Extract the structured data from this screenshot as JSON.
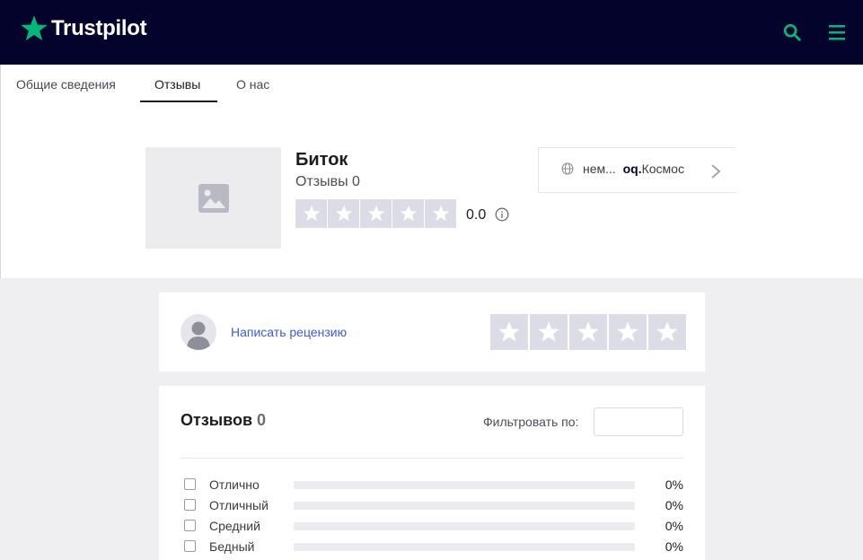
{
  "header": {
    "logo_text": "Trustpilot",
    "accent": "#00b67a",
    "background": "#04032c"
  },
  "tabs": [
    {
      "label": "Общие сведения"
    },
    {
      "label": "Отзывы",
      "active": true
    },
    {
      "label": "О нас"
    }
  ],
  "company": {
    "name": "Биток",
    "reviews_label": "Отзывы 0",
    "rating": "0.0",
    "stars_filled": 0,
    "website_prefix": "нем...",
    "website_domain": "oq.",
    "website_suffix": "Космос"
  },
  "write_review": {
    "link": "Написать рецензию"
  },
  "reviews": {
    "title": "Отзывов",
    "count": "0",
    "filter_label": "Фильтровать по:",
    "rows": [
      {
        "label": "Отлично",
        "percent": "0%",
        "fill": 0
      },
      {
        "label": "Отличный",
        "percent": "0%",
        "fill": 0
      },
      {
        "label": "Средний",
        "percent": "0%",
        "fill": 0
      },
      {
        "label": "Бедный",
        "percent": "0%",
        "fill": 0
      }
    ]
  }
}
